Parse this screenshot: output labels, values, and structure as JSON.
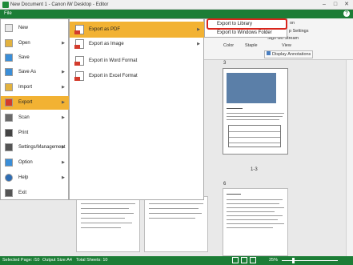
{
  "window": {
    "title": "New Document 1 - Canon iW Desktop - Editor",
    "minimize": "–",
    "maximize": "□",
    "close": "✕"
  },
  "menubar": {
    "file": "File",
    "help": "?"
  },
  "ribbon": {
    "on_label": "on",
    "settings_label": "p Settings",
    "custom_label": "Sign Go Stream",
    "color_label": "Color",
    "staple_label": "Staple",
    "view_label": "View",
    "display_annotations": "Display Annotations"
  },
  "file_menu": {
    "items": [
      {
        "label": "New",
        "icon": "new-document-icon",
        "arrow": false
      },
      {
        "label": "Open",
        "icon": "open-folder-icon",
        "arrow": true
      },
      {
        "label": "Save",
        "icon": "save-icon",
        "arrow": false
      },
      {
        "label": "Save As",
        "icon": "save-as-icon",
        "arrow": true
      },
      {
        "label": "Import",
        "icon": "import-icon",
        "arrow": true
      },
      {
        "label": "Export",
        "icon": "export-icon",
        "arrow": true
      },
      {
        "label": "Scan",
        "icon": "scanner-icon",
        "arrow": true
      },
      {
        "label": "Print",
        "icon": "printer-icon",
        "arrow": false
      },
      {
        "label": "Settings/Management",
        "icon": "settings-gear-icon",
        "arrow": true
      },
      {
        "label": "Option",
        "icon": "option-gear-icon",
        "arrow": true
      },
      {
        "label": "Help",
        "icon": "help-icon",
        "arrow": true
      },
      {
        "label": "Exit",
        "icon": "exit-icon",
        "arrow": false
      }
    ],
    "selected": "Export"
  },
  "export_submenu": {
    "items": [
      {
        "label": "Export as PDF"
      },
      {
        "label": "Export as Image"
      },
      {
        "label": "Export in Word Format"
      },
      {
        "label": "Export in Excel Format"
      }
    ],
    "selected": "Export as PDF"
  },
  "pdf_submenu": {
    "items": [
      {
        "label": "Export to Library"
      },
      {
        "label": "Export to Windows Folder"
      }
    ],
    "highlighted": "Export to Library"
  },
  "pages": {
    "page3_number": "3",
    "range_label": "1-3",
    "page6_number": "6"
  },
  "status": {
    "selected_page": "Selected Page: /10",
    "output_size": "Output Size:A4",
    "total_sheets": "Total Sheets: 10",
    "zoom": "25%"
  },
  "colors": {
    "accent_green": "#1c7d36",
    "menu_highlight": "#f2b233",
    "callout_red": "#d9261c"
  }
}
